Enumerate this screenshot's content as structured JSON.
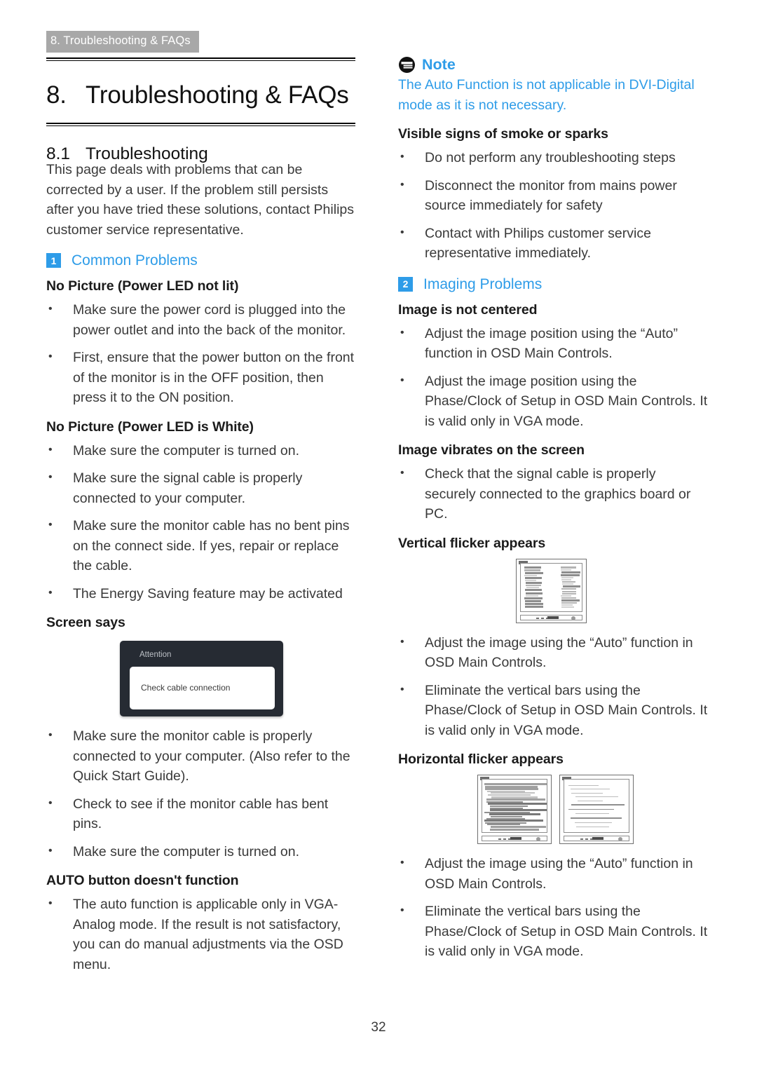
{
  "header_tab": "8. Troubleshooting & FAQs",
  "chapter": {
    "number": "8.",
    "title": "Troubleshooting & FAQs"
  },
  "section": {
    "number": "8.1",
    "title": "Troubleshooting"
  },
  "page_number": "32",
  "colors": {
    "accent_blue": "#2e9ce8",
    "header_tab_bg": "#a8a8a8",
    "body_text": "#3a3a3a",
    "osd_box_bg": "#262b33"
  },
  "left_column": {
    "intro": "This page deals with problems that can be corrected by a user. If the problem still persists after you have tried these solutions, contact Philips customer service representative.",
    "group_1": {
      "badge": "1",
      "label": "Common Problems"
    },
    "h_no_picture_not_lit": "No Picture (Power LED not lit)",
    "bullets_not_lit": [
      "Make sure the power cord is plugged into the power outlet and into the back of the monitor.",
      "First, ensure that the power button on the front of the monitor is in the OFF position, then press it to the ON position."
    ],
    "h_no_picture_white": "No Picture (Power LED is White)",
    "bullets_white": [
      "Make sure the computer is turned on.",
      "Make sure the signal cable is properly connected to your computer.",
      "Make sure the monitor cable has no bent pins on the connect side. If yes, repair or replace the cable.",
      "The Energy Saving feature may be activated"
    ],
    "h_screen_says": "Screen says",
    "osd_figure": {
      "title": "Attention",
      "message": "Check cable connection"
    },
    "bullets_screen_says": [
      "Make sure the monitor cable is properly connected to your computer. (Also refer to the Quick Start Guide).",
      "Check to see if the monitor cable has bent pins.",
      "Make sure the computer is turned on."
    ],
    "h_auto_button": "AUTO button doesn't function",
    "bullets_auto_button": [
      "The auto function is applicable only in VGA-Analog mode.  If the result is not satisfactory, you can do manual adjustments via the OSD menu."
    ]
  },
  "right_column": {
    "note": {
      "icon": "note-icon",
      "label": "Note",
      "text": "The Auto Function is not applicable in DVI-Digital mode as it is not necessary."
    },
    "h_smoke": "Visible signs of smoke or sparks",
    "bullets_smoke": [
      "Do not perform any troubleshooting steps",
      "Disconnect the monitor from mains power source immediately for safety",
      "Contact with Philips customer service representative immediately."
    ],
    "group_2": {
      "badge": "2",
      "label": "Imaging Problems"
    },
    "h_not_centered": "Image is not centered",
    "bullets_not_centered": [
      "Adjust the image position using the “Auto” function in OSD Main Controls.",
      "Adjust the image position using the Phase/Clock of Setup in OSD Main Controls.  It is valid only in VGA mode."
    ],
    "h_vibrates": "Image vibrates on the screen",
    "bullets_vibrates": [
      "Check that the signal cable is properly securely connected to the graphics board or PC."
    ],
    "h_vertical_flicker": "Vertical flicker appears",
    "bullets_vertical_flicker": [
      "Adjust the image using the “Auto” function in OSD Main Controls.",
      "Eliminate the vertical bars using the Phase/Clock of Setup in OSD Main Controls. It is valid only in VGA mode."
    ],
    "h_horizontal_flicker": "Horizontal flicker appears",
    "bullets_horizontal_flicker": [
      "Adjust the image using the “Auto” function in OSD Main Controls.",
      "Eliminate the vertical bars using the Phase/Clock of Setup in OSD Main Controls. It is valid only in VGA mode."
    ]
  }
}
